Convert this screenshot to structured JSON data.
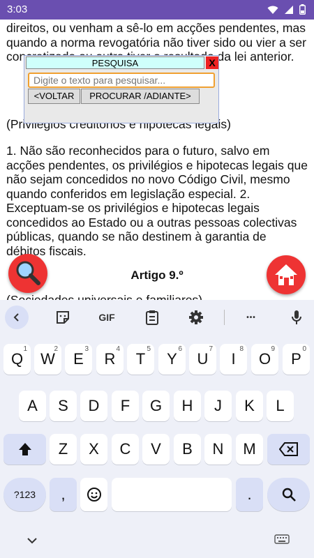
{
  "status_bar": {
    "time": "3:03"
  },
  "document": {
    "paragraph1": "direitos, ou venham a sê-lo em acções pendentes, mas quando a norma revogatória não tiver sido ou vier a ser concretizada ou outra tiver o resultado da lei anterior.",
    "paragraph2": "(Privilégios creditórios e hipotecas legais)",
    "paragraph3": "1. Não são reconhecidos para o futuro, salvo em acções pendentes, os privilégios e hipotecas legais que não sejam concedidos no novo Código Civil, mesmo quando conferidos em legislação especial. 2. Exceptuam-se os privilégios e hipotecas legais concedidos ao Estado ou a outras pessoas colectivas públicas, quando se não destinem à garantia de débitos fiscais.",
    "article_heading": "Artigo 9.º",
    "paragraph4": "(Sociedades universais e familiares)"
  },
  "search_dialog": {
    "title": "PESQUISA",
    "close_label": "X",
    "placeholder": "Digite o texto para pesquisar...",
    "back_label": "<VOLTAR",
    "forward_label": "PROCURAR /ADIANTE>"
  },
  "keyboard": {
    "toolbar": {
      "gif_label": "GIF",
      "more_label": "•••"
    },
    "row1": [
      {
        "key": "Q",
        "hint": "1"
      },
      {
        "key": "W",
        "hint": "2"
      },
      {
        "key": "E",
        "hint": "3"
      },
      {
        "key": "R",
        "hint": "4"
      },
      {
        "key": "T",
        "hint": "5"
      },
      {
        "key": "Y",
        "hint": "6"
      },
      {
        "key": "U",
        "hint": "7"
      },
      {
        "key": "I",
        "hint": "8"
      },
      {
        "key": "O",
        "hint": "9"
      },
      {
        "key": "P",
        "hint": "0"
      }
    ],
    "row2": [
      "A",
      "S",
      "D",
      "F",
      "G",
      "H",
      "J",
      "K",
      "L"
    ],
    "row3": [
      "Z",
      "X",
      "C",
      "V",
      "B",
      "N",
      "M"
    ],
    "symbols_label": "?123",
    "comma_label": ",",
    "period_label": "."
  },
  "colors": {
    "status_bar": "#6a4fb0",
    "fab": "#e33333",
    "keyboard_bg": "#eef0f8",
    "accent_key": "#d9dff6"
  }
}
